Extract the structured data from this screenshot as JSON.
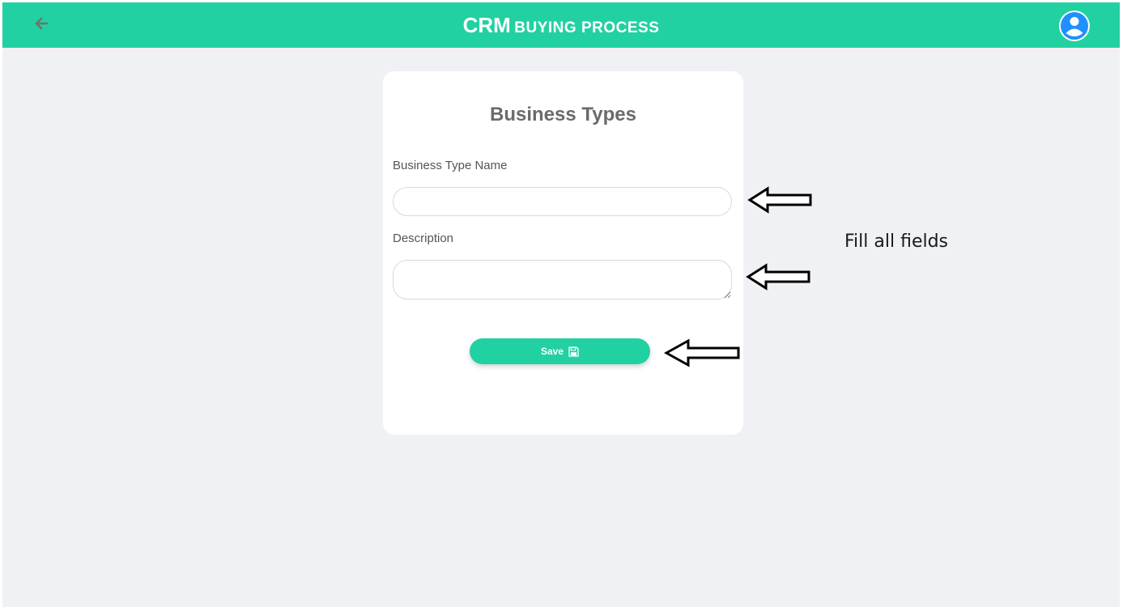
{
  "header": {
    "title_main": "CRM",
    "title_sub": "BUYING PROCESS",
    "back_icon": "arrow-left-icon",
    "profile_icon": "user-circle-icon",
    "bar_color": "#22d1a2"
  },
  "form": {
    "title": "Business Types",
    "fields": [
      {
        "label": "Business Type Name",
        "value": "",
        "placeholder": ""
      },
      {
        "label": "Description",
        "value": "",
        "placeholder": ""
      }
    ],
    "save_label": "Save",
    "save_icon": "floppy-disk-icon"
  },
  "annotation": {
    "note": "Fill all fields",
    "arrow_icon": "left-arrow-outline-icon"
  }
}
